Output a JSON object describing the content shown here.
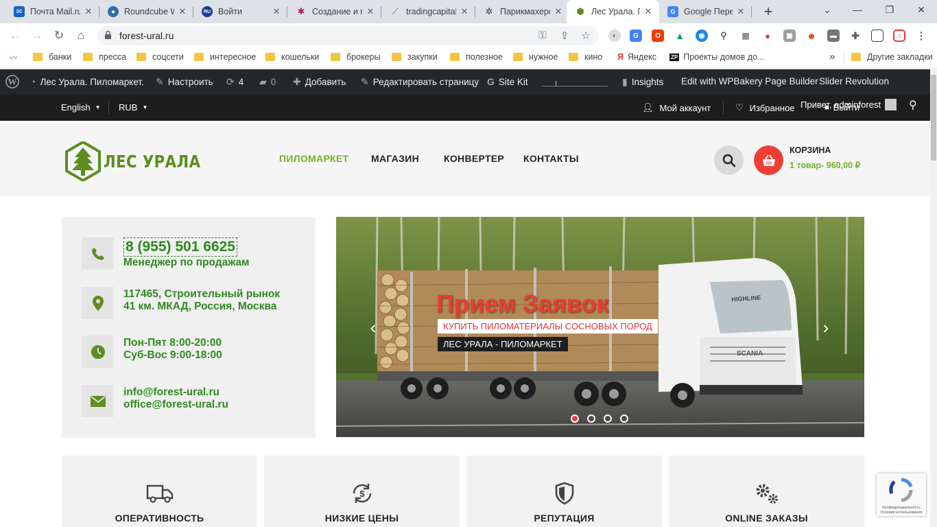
{
  "browser": {
    "tabs": [
      {
        "title": "Почта Mail.ru",
        "icon": "mail-icon",
        "active": false
      },
      {
        "title": "Roundcube W",
        "icon": "roundcube-icon",
        "active": false
      },
      {
        "title": "Войти",
        "icon": "ru-icon",
        "active": false
      },
      {
        "title": "Создание и п",
        "icon": "slack-icon",
        "active": false
      },
      {
        "title": "tradingcapital",
        "icon": "chart-icon",
        "active": false
      },
      {
        "title": "Парикмахерс",
        "icon": "spider-icon",
        "active": false
      },
      {
        "title": "Лес Урала. П",
        "icon": "forest-icon",
        "active": true
      },
      {
        "title": "Google Пере",
        "icon": "google-translate-icon",
        "active": false
      }
    ],
    "url": "forest-ural.ru",
    "bookmarks": [
      {
        "label": "",
        "icon": "bookmark-app-icon"
      },
      {
        "label": "банки"
      },
      {
        "label": "пресса"
      },
      {
        "label": "соцсети"
      },
      {
        "label": "интересное"
      },
      {
        "label": "кошельки"
      },
      {
        "label": "брокеры"
      },
      {
        "label": "закупки"
      },
      {
        "label": "полезное"
      },
      {
        "label": "нужное"
      },
      {
        "label": "кино"
      },
      {
        "label": "Яндекс",
        "icon": "yandex-icon"
      },
      {
        "label": "Проекты домов до...",
        "icon": "zp-icon"
      }
    ],
    "more_bookmarks": "»",
    "other_bookmarks": "Другие закладки"
  },
  "wp_admin": {
    "site_name": "Лес Урала. Пиломаркет.",
    "customize": "Настроить",
    "updates": "4",
    "comments": "0",
    "add_new": "Добавить",
    "edit_page": "Редактировать страницу",
    "site_kit": "Site Kit",
    "insights": "Insights",
    "wpbakery": "Edit with WPBakery Page Builder",
    "slider_rev": "Slider Revolution"
  },
  "topbar": {
    "language": "English",
    "currency": "RUB",
    "my_account": "Мой аккаунт",
    "favorites": "Избранное",
    "logout": "Выйти",
    "greeting": "Привет, adminforest"
  },
  "header": {
    "logo_text": "ЛЕС УРАЛА",
    "nav": [
      {
        "label": "ПИЛОМАРКЕТ",
        "active": true
      },
      {
        "label": "МАГАЗИН",
        "active": false
      },
      {
        "label": "КОНВЕРТЕР",
        "active": false
      },
      {
        "label": "КОНТАКТЫ",
        "active": false
      }
    ],
    "cart_title": "КОРЗИНА",
    "cart_summary": "1 товар- 960,00 ₽"
  },
  "contacts": {
    "phone": "8 (955) 501 6625",
    "phone_label": "Менеджер по продажам",
    "address_line1": "117465, Строительный рынок",
    "address_line2": "41 км. МКАД, Россия, Москва",
    "hours_line1": "Пон-Пят 8:00-20:00",
    "hours_line2": "Суб-Вос 9:00-18:00",
    "email1": "info@forest-ural.ru",
    "email2": "office@forest-ural.ru"
  },
  "slider": {
    "title": "Прием Заявок",
    "caption1": "КУПИТЬ ПИЛОМАТЕРИАЛЫ СОСНОВЫХ ПОРОД",
    "caption2": "ЛЕС УРАЛА - ПИЛОМАРКЕТ",
    "truck_brand": "HIGHLINE",
    "truck_make": "SCANIA",
    "dots": 4,
    "active_dot": 1
  },
  "features": [
    {
      "title": "ОПЕРАТИВНОСТЬ",
      "icon": "truck-icon"
    },
    {
      "title": "НИЗКИЕ ЦЕНЫ",
      "icon": "dollar-refresh-icon"
    },
    {
      "title": "РЕПУТАЦИЯ",
      "icon": "shield-icon"
    },
    {
      "title": "ONLINE ЗАКАЗЫ",
      "icon": "gears-icon"
    }
  ],
  "recaptcha": {
    "line1": "Конфиденциальность",
    "line2": "Условия использования"
  },
  "colors": {
    "brand_green": "#73b12e",
    "dark_green": "#2e8a1e",
    "accent_red": "#ef3e36",
    "admin_bar": "#23282d"
  }
}
